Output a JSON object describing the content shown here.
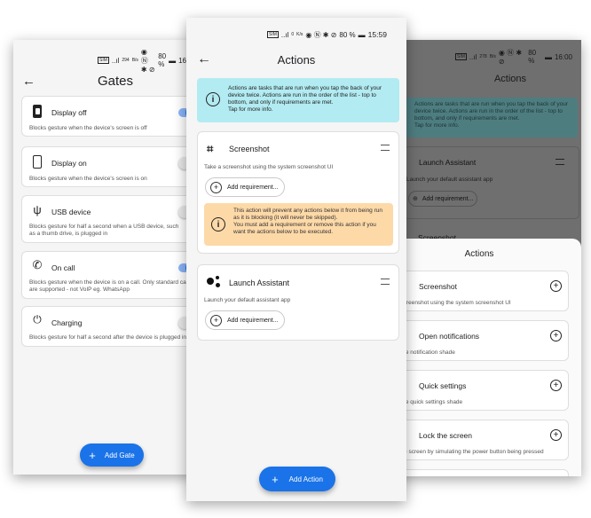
{
  "left": {
    "status": {
      "sim": "SIM",
      "signal": "..ıl",
      "speed_value": "294",
      "speed_unit": "B/s",
      "icons": "◉ Ⓝ ✱ ⊘",
      "battery": "80 %",
      "battery_icon": "▬",
      "time": "16"
    },
    "title": "Gates",
    "back_icon": "←",
    "gates": [
      {
        "label": "Display off",
        "desc": "Blocks gesture when the device's screen is off",
        "enabled": true,
        "icon": "phone-off-icon"
      },
      {
        "label": "Display on",
        "desc": "Blocks gesture when the device's screen is on",
        "enabled": false,
        "icon": "phone-on-icon"
      },
      {
        "label": "USB device",
        "desc": "Blocks gesture for half a second when a USB device, such as a thumb drive, is plugged in",
        "enabled": false,
        "icon": "usb-icon"
      },
      {
        "label": "On call",
        "desc": "Blocks gesture when the device is on a call. Only standard calls are supported - not VoIP eg. WhatsApp",
        "enabled": true,
        "icon": "phone-call-icon"
      },
      {
        "label": "Charging",
        "desc": "Blocks gesture for half a second after the device is plugged in",
        "enabled": false,
        "icon": "plug-icon"
      }
    ],
    "fab_label": "Add Gate"
  },
  "center": {
    "status": {
      "sim": "SIM",
      "signal": "..ıl",
      "speed_value": "0",
      "speed_unit": "K/s",
      "icons": "◉ Ⓝ ✱ ⊘",
      "battery": "80 %",
      "battery_icon": "▬",
      "time": "15:59"
    },
    "title": "Actions",
    "back_icon": "←",
    "info": "Actions are tasks that are run when you tap the back of your device twice. Actions are run in the order of the list - top to bottom, and only if requirements are met.\nTap for more info.",
    "actions": [
      {
        "name": "Screenshot",
        "desc": "Take a screenshot using the system screenshot UI",
        "add_req": "Add requirement..."
      },
      {
        "name": "Launch Assistant",
        "desc": "Launch your default assistant app",
        "add_req": "Add requirement..."
      }
    ],
    "warning": "This action will prevent any actions below it from being run as it is blocking (it will never be skipped).\nYou must add a requirement or remove this action if you want the actions below to be executed.",
    "fab_label": "Add Action"
  },
  "right": {
    "status": {
      "sim": "SIM",
      "signal": "..ıl",
      "speed_value": "278",
      "speed_unit": "B/s",
      "icons": "◉ Ⓝ ✱ ⊘",
      "battery": "80 %",
      "battery_icon": "▬",
      "time": "16:00"
    },
    "title": "Actions",
    "info": "Actions are tasks that are run when you tap the back of your device twice. Actions are run in the order of the list - top to bottom, and only if requirements are met.\nTap for more info.",
    "bg_actions": [
      {
        "name": "Launch Assistant",
        "desc": "Launch your default assistant app",
        "add_req": "Add requirement..."
      },
      {
        "name": "Screenshot"
      }
    ],
    "sheet_title": "Actions",
    "sheet_items": [
      {
        "name": "Screenshot",
        "desc": "a screenshot using the system screenshot UI"
      },
      {
        "name": "Open notifications",
        "desc": "n the notification shade"
      },
      {
        "name": "Quick settings",
        "desc": "n the quick settings shade"
      },
      {
        "name": "Lock the screen",
        "desc": ", the screen by simulating the power button being pressed"
      }
    ]
  }
}
